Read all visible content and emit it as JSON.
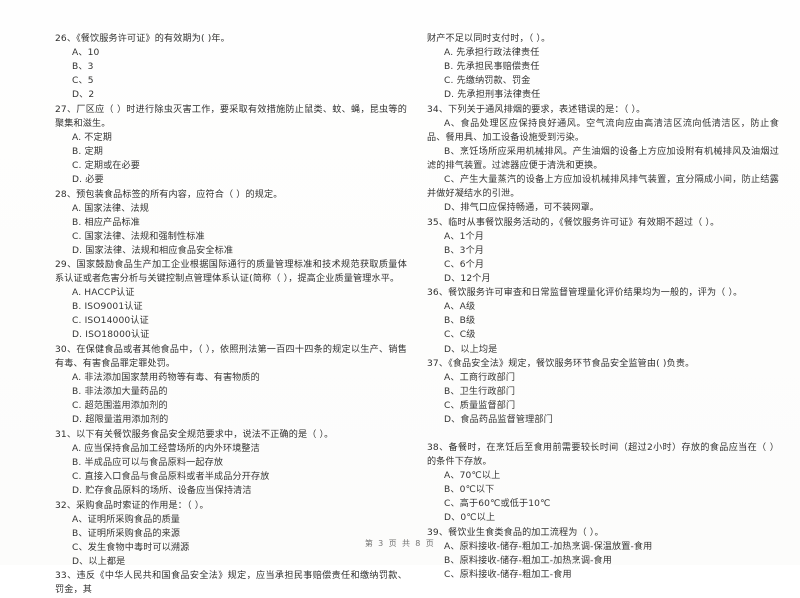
{
  "document": {
    "type": "scanned-exam-paper",
    "language": "zh-CN",
    "footer": {
      "prefix": "第",
      "page": "3",
      "middle": "页 共",
      "total": "8",
      "suffix": "页",
      "full": "第 3 页 共 8 页"
    }
  },
  "left_column": {
    "questions": [
      {
        "id": "q26",
        "stem": "26、《餐饮服务许可证》的有效期为(      )年。",
        "options": [
          "A、10",
          "B、3",
          "C、5",
          "D、2"
        ]
      },
      {
        "id": "q27",
        "stem": "27、厂区应（       ）时进行除虫灭害工作，要采取有效措施防止鼠类、蚊、蝇，昆虫等的聚集和滋生。",
        "options": [
          "A. 不定期",
          "B. 定期",
          "C. 定期或在必要",
          "D. 必要"
        ]
      },
      {
        "id": "q28",
        "stem": "28、预包装食品标签的所有内容，应符合（      ）的规定。",
        "options": [
          "A. 国家法律、法规",
          "B. 相应产品标准",
          "C. 国家法律、法规和强制性标准",
          "D. 国家法律、法规和相应食品安全标准"
        ]
      },
      {
        "id": "q29",
        "stem": "29、国家鼓励食品生产加工企业根据国际通行的质量管理标准和技术规范获取质量体系认证或者危害分析与关键控制点管理体系认证(简称（      ），提高企业质量管理水平。",
        "options": [
          "A. HACCP认证",
          "B. ISO9001认证",
          "C. ISO14000认证",
          "D. ISO18000认证"
        ]
      },
      {
        "id": "q30",
        "stem": "30、在保健食品或者其他食品中，（      ），依照刑法第一百四十四条的规定以生产、销售有毒、有害食品罪定罪处罚。",
        "options": [
          "A. 非法添加国家禁用药物等有毒、有害物质的",
          "B. 非法添加大量药品的",
          "C. 超范围滥用添加剂的",
          "D. 超限量滥用添加剂的"
        ]
      },
      {
        "id": "q31",
        "stem": "31、以下有关餐饮服务食品安全规范要求中，说法不正确的是（      ）。",
        "options": [
          "A. 应当保持食品加工经营场所的内外环境整洁",
          "B. 半成品应可以与食品原料一起存放",
          "C. 直接入口食品与食品原料或者半成品分开存放",
          "D. 贮存食品原料的场所、设备应当保持清洁"
        ]
      },
      {
        "id": "q32",
        "stem": "32、采购食品时索证的作用是：（      ）。",
        "options": [
          "A、证明所采购食品的质量",
          "B、证明所采购食品的来源",
          "C、发生食物中毒时可以溯源",
          "D、以上都是"
        ]
      },
      {
        "id": "q33",
        "stem": "33、违反《中华人民共和国食品安全法》规定，应当承担民事赔偿责任和缴纳罚款、罚金，其",
        "options": []
      }
    ]
  },
  "right_column": {
    "questions": [
      {
        "id": "q33-cont",
        "stem": "财产不足以同时支付时，（      ）。",
        "options": [
          "A. 先承担行政法律责任",
          "B. 先承担民事赔偿责任",
          "C. 先缴纳罚款、罚金",
          "D. 先承担刑事法律责任"
        ]
      },
      {
        "id": "q34",
        "stem": "34、下列关于通风排烟的要求，表述错误的是：（      ）。",
        "long_options": [
          "A、食品处理区应保持良好通风。空气流向应由高清洁区流向低清洁区，防止食品、餐用具、加工设备设施受到污染。",
          "B、烹饪场所应采用机械排风。产生油烟的设备上方应加设附有机械排风及油烟过滤的排气装置。过滤器应便于清洗和更换。",
          "C、产生大量蒸汽的设备上方应加设机械排风排气装置，宜分隔成小间，防止结露并做好凝结水的引泄。",
          "D、排气口应保持畅通，可不装网罩。"
        ],
        "options": []
      },
      {
        "id": "q35",
        "stem": "35、临时从事餐饮服务活动的，《餐饮服务许可证》有效期不超过（      ）。",
        "options": [
          "A、1个月",
          "B、3个月",
          "C、6个月",
          "D、12个月"
        ]
      },
      {
        "id": "q36",
        "stem": "36、餐饮服务许可审查和日常监督管理量化评价结果均为一般的，评为（      ）。",
        "options": [
          "A、A级",
          "B、B级",
          "C、C级",
          "D、以上均是"
        ]
      },
      {
        "id": "q37",
        "stem": "37、《食品安全法》规定，餐饮服务环节食品安全监管由(      )负责。",
        "options": [
          "A、工商行政部门",
          "B、卫生行政部门",
          "C、质量监督部门",
          "D、食品药品监督管理部门"
        ]
      },
      {
        "id": "q38",
        "stem": "38、备餐时，在烹饪后至食用前需要较长时间（超过2小时）存放的食品应当在（      ）的条件下存放。",
        "options": [
          "A、70℃以上",
          "B、0℃以下",
          "C、高于60℃或低于10℃",
          "D、0℃以上"
        ]
      },
      {
        "id": "q39",
        "stem": "39、餐饮业生食类食品的加工流程为（      ）。",
        "options": [
          "A、原料接收-储存-粗加工-加热烹调-保温放置-食用",
          "B、原料接收-储存-粗加工-加热烹调-食用",
          "C、原料接收-储存-粗加工-食用"
        ]
      }
    ]
  }
}
